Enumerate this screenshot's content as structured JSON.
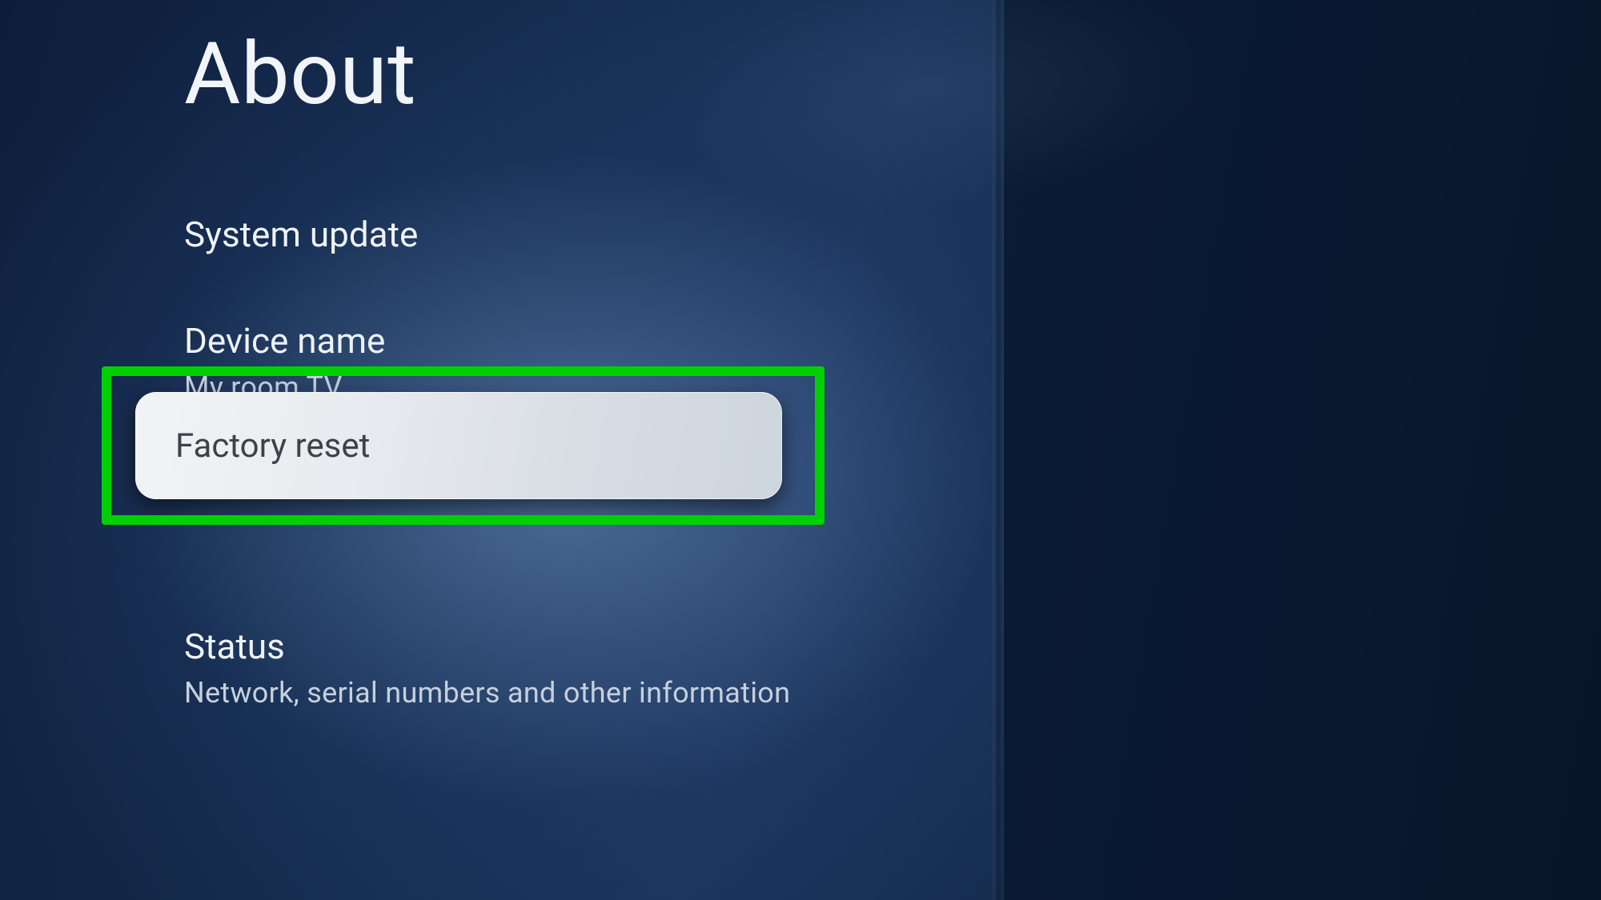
{
  "page": {
    "title": "About"
  },
  "items": {
    "system_update": {
      "title": "System update"
    },
    "device_name": {
      "title": "Device name",
      "subtitle": "My room TV"
    },
    "factory_reset": {
      "title": "Factory reset"
    },
    "status": {
      "title": "Status",
      "subtitle": "Network, serial numbers and other information"
    }
  }
}
